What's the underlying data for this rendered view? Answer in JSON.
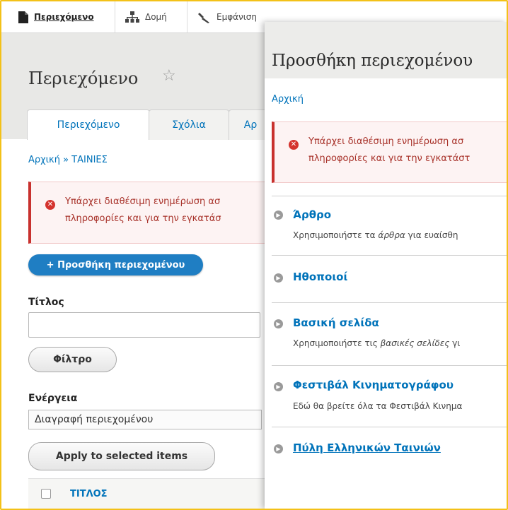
{
  "toolbar": {
    "items": [
      {
        "label": "Περιεχόμενο",
        "icon": "file-icon"
      },
      {
        "label": "Δομή",
        "icon": "sitemap-icon"
      },
      {
        "label": "Εμφάνιση",
        "icon": "wrench-icon"
      }
    ]
  },
  "left": {
    "page_title": "Περιεχόμενο",
    "tabs": [
      "Περιεχόμενο",
      "Σχόλια",
      "Αρ"
    ],
    "breadcrumb": "Αρχική » ΤΑΙΝΙΕΣ",
    "message": {
      "line1": "Υπάρχει διαθέσιμη ενημέρωση ασ",
      "line2": "πληροφορίες και για την εγκατάσ"
    },
    "add_button": "+ Προσθήκη περιεχομένου",
    "title_filter_label": "Τίτλος",
    "filter_button": "Φίλτρο",
    "action_label": "Ενέργεια",
    "action_value": "Διαγραφή περιεχομένου",
    "apply_button": "Apply to selected items",
    "table_header_title": "ΤΙΤΛΟΣ"
  },
  "right": {
    "title": "Προσθήκη περιεχομένου",
    "breadcrumb": "Αρχική",
    "message": {
      "line1": "Υπάρχει διαθέσιμη ενημέρωση ασ",
      "line2": "πληροφορίες και για την εγκατάστ"
    },
    "types": [
      {
        "title": "Άρθρο",
        "desc_pre": "Χρησιμοποιήστε τα ",
        "desc_em": "άρθρα",
        "desc_post": " για ευαίσθη"
      },
      {
        "title": "Ηθοποιοί",
        "desc_pre": "",
        "desc_em": "",
        "desc_post": ""
      },
      {
        "title": "Βασική σελίδα",
        "desc_pre": "Χρησιμοποιήστε τις ",
        "desc_em": "βασικές σελίδες",
        "desc_post": " γι"
      },
      {
        "title": "Φεστιβάλ Κινηματογράφου",
        "desc_pre": "Εδώ θα βρείτε όλα τα Φεστιβάλ Κινημα",
        "desc_em": "",
        "desc_post": ""
      },
      {
        "title": "Πύλη Ελληνικών Ταινιών",
        "desc_pre": "",
        "desc_em": "",
        "desc_post": ""
      }
    ]
  },
  "colors": {
    "accent_link": "#0073ba",
    "error_red": "#c8312e",
    "primary_button": "#1f7ec3",
    "frame_border": "#f3c118"
  }
}
